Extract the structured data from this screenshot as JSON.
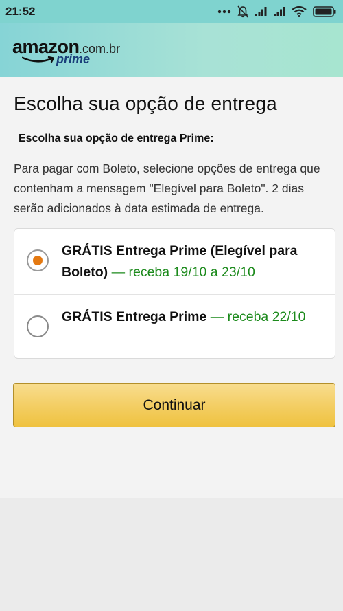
{
  "status_bar": {
    "time": "21:52",
    "icons": [
      "dots-icon",
      "bell-muted-icon",
      "signal-icon",
      "signal-icon",
      "wifi-icon",
      "battery-icon"
    ]
  },
  "header": {
    "logo_amazon": "amazon",
    "logo_domain": ".com.br",
    "logo_prime": "prime"
  },
  "main": {
    "title": "Escolha sua opção de entrega",
    "subtitle": "Escolha sua opção de entrega Prime:",
    "info": "Para pagar com Boleto, selecione opções de entrega que contenham a mensagem \"Elegível para Boleto\". 2 dias serão adicionados à data estimada de entrega.",
    "options": [
      {
        "label_bold": "GRÁTIS Entrega Prime (Elegível para Boleto)",
        "separator": " — ",
        "delivery": "receba 19/10 a 23/10",
        "selected": true
      },
      {
        "label_bold": "GRÁTIS Entrega Prime",
        "separator": " — ",
        "delivery": "receba 22/10",
        "selected": false
      }
    ],
    "continue_label": "Continuar"
  },
  "colors": {
    "status_bar": "#7fd3cf",
    "header_gradient_start": "#86d4d6",
    "header_gradient_end": "#a7e5d0",
    "radio_selected": "#e47911",
    "delivery_green": "#1c8a1c",
    "button_yellow": "#f3cd61"
  }
}
